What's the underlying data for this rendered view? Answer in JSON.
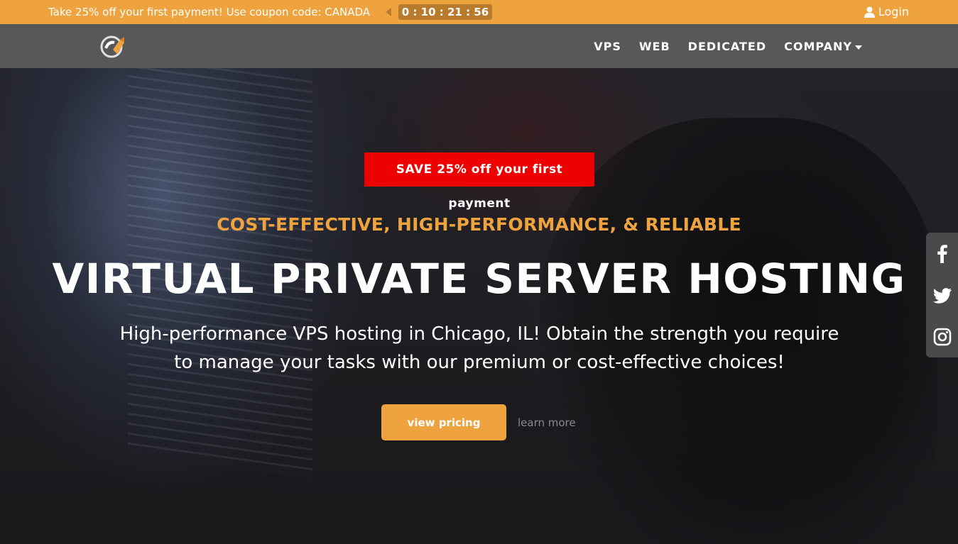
{
  "promo": {
    "text": "Take 25% off your first payment! Use coupon code: CANADA",
    "timer": "0 : 10 : 21 : 56",
    "login_label": "Login"
  },
  "nav": {
    "items": [
      "VPS",
      "WEB",
      "DEDICATED",
      "COMPANY"
    ]
  },
  "hero": {
    "badge": "SAVE 25% off your first payment",
    "subtitle": "COST-EFFECTIVE, HIGH-PERFORMANCE, & RELIABLE",
    "title": "VIRTUAL PRIVATE SERVER HOSTING",
    "description": "High-performance VPS hosting in Chicago, IL! Obtain the strength you require to manage your tasks with our premium or cost-effective choices!",
    "primary_button": "view pricing",
    "secondary_link": "learn more"
  },
  "social": [
    "facebook-icon",
    "twitter-icon",
    "instagram-icon"
  ],
  "colors": {
    "accent": "#eea33f",
    "timer_bg": "#b87b2c",
    "navbar": "#58585a",
    "badge": "#ee0000"
  }
}
